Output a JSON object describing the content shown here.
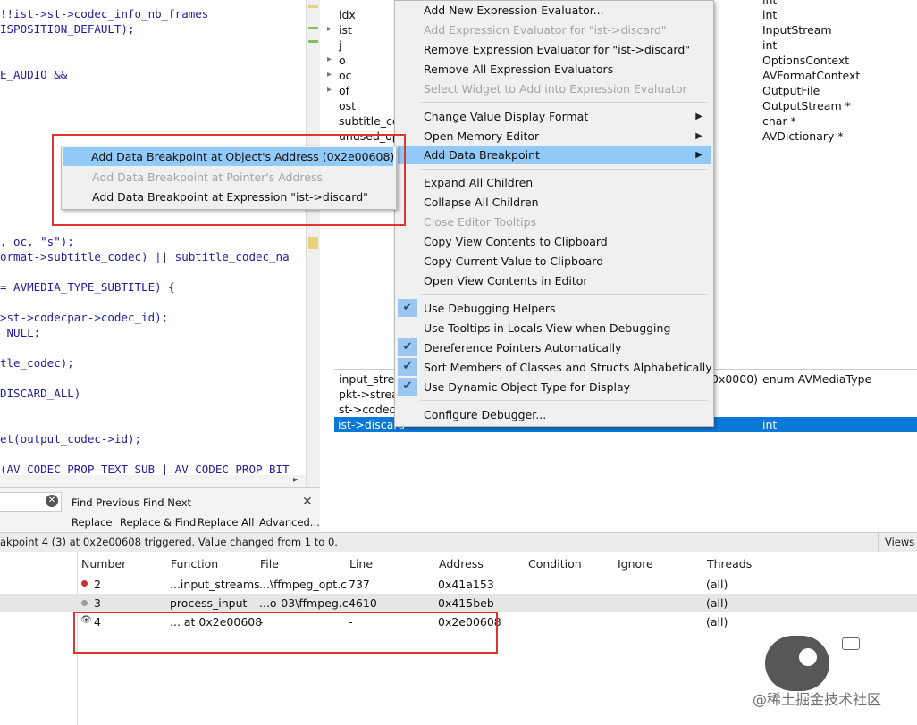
{
  "code_lines": [
    "!!ist->st->codec_info_nb_frames",
    "ISPOSITION_DEFAULT);",
    "E_AUDIO &&",
    ", oc, \"s\");",
    "ormat->subtitle_codec) || subtitle_codec_na",
    "= AVMEDIA_TYPE_SUBTITLE) {",
    ">st->codecpar->codec_id);",
    " NULL;",
    "tle_codec);",
    "DISCARD_ALL)",
    "et(output_codec->id);",
    "(AV_CODEC_PROP_TEXT_SUB | AV_CODEC_PROP_BIT"
  ],
  "locals": {
    "names": [
      "idx",
      "ist",
      "j",
      "o",
      "oc",
      "of",
      "ost",
      "subtitle_co",
      "unused_op"
    ],
    "types": [
      "int",
      "int",
      "InputStream",
      "int",
      "OptionsContext",
      "AVFormatContext",
      "OutputFile",
      "OutputStream *",
      "char *",
      "AVDictionary *"
    ],
    "watch_names": [
      "input_strea",
      "pkt->strea",
      "st->codec",
      "ist->discard"
    ],
    "watch_value_fragment": "0x0000)",
    "watch_type_1": "enum AVMediaType",
    "watch_type_4": "int"
  },
  "context_menu": {
    "items": [
      {
        "label": "Add New Expression Evaluator...",
        "disabled": false
      },
      {
        "label": "Add Expression Evaluator for \"ist->discard\"",
        "disabled": true
      },
      {
        "label": "Remove Expression Evaluator for \"ist->discard\"",
        "disabled": false
      },
      {
        "label": "Remove All Expression Evaluators",
        "disabled": false
      },
      {
        "label": "Select Widget to Add into Expression Evaluator",
        "disabled": true
      },
      {
        "label": "Change Value Display Format",
        "disabled": false,
        "submenu": true
      },
      {
        "label": "Open Memory Editor",
        "disabled": false,
        "submenu": true
      },
      {
        "label": "Add Data Breakpoint",
        "disabled": false,
        "submenu": true,
        "highlighted": true
      },
      {
        "label": "Expand All Children",
        "disabled": false
      },
      {
        "label": "Collapse All Children",
        "disabled": false
      },
      {
        "label": "Close Editor Tooltips",
        "disabled": true
      },
      {
        "label": "Copy View Contents to Clipboard",
        "disabled": false
      },
      {
        "label": "Copy Current Value to Clipboard",
        "disabled": false
      },
      {
        "label": "Open View Contents in Editor",
        "disabled": false
      },
      {
        "label": "Use Debugging Helpers",
        "checked": true
      },
      {
        "label": "Use Tooltips in Locals View when Debugging",
        "checked": false
      },
      {
        "label": "Dereference Pointers Automatically",
        "checked": true
      },
      {
        "label": "Sort Members of Classes and Structs Alphabetically",
        "checked": true
      },
      {
        "label": "Use Dynamic Object Type for Display",
        "checked": true
      },
      {
        "label": "Configure Debugger...",
        "disabled": false
      }
    ]
  },
  "submenu": {
    "items": [
      {
        "label": "Add Data Breakpoint at Object's Address (0x2e00608)",
        "disabled": false,
        "highlighted": true
      },
      {
        "label": "Add Data Breakpoint at Pointer's Address",
        "disabled": true
      },
      {
        "label": "Add Data Breakpoint at Expression \"ist->discard\"",
        "disabled": false
      }
    ]
  },
  "findbar": {
    "find_previous": "Find Previous",
    "find_next": "Find Next",
    "replace": "Replace",
    "replace_find": "Replace & Find",
    "replace_all": "Replace All",
    "advanced": "Advanced..."
  },
  "status_text": "akpoint 4 (3) at 0x2e00608 triggered. Value changed from 1 to 0.",
  "views_label": "Views",
  "breakpoints": {
    "headers": [
      "Number",
      "Function",
      "File",
      "Line",
      "Address",
      "Condition",
      "Ignore",
      "Threads"
    ],
    "rows": [
      {
        "number": "2",
        "function": "...input_streams",
        "file": "...\\ffmpeg_opt.c",
        "line": "737",
        "address": "0x41a153",
        "threads": "(all)"
      },
      {
        "number": "3",
        "function": "process_input",
        "file": "...o-03\\ffmpeg.c",
        "line": "4610",
        "address": "0x415beb",
        "threads": "(all)"
      },
      {
        "number": "4",
        "function": "... at 0x2e00608",
        "file": "-",
        "line": "-",
        "address": "0x2e00608",
        "threads": "(all)"
      }
    ]
  },
  "watermark": "@稀土掘金技术社区",
  "colors": {
    "accent": "#0a78d7",
    "menu_highlight": "#91c9f7",
    "annotation": "#e0342e"
  }
}
